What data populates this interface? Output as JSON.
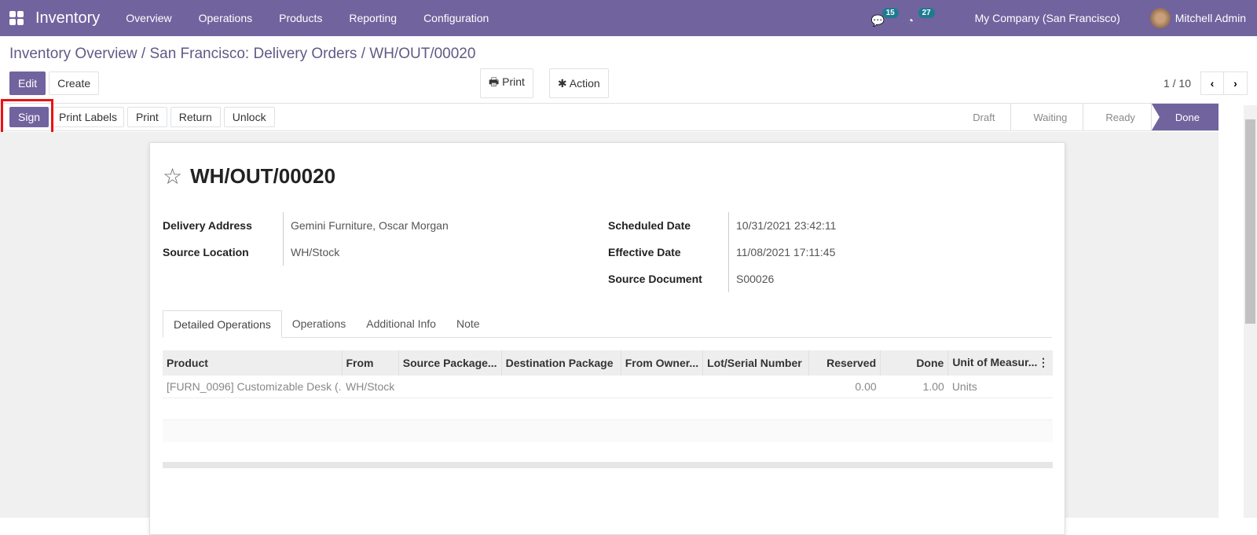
{
  "nav": {
    "app": "Inventory",
    "menu": [
      "Overview",
      "Operations",
      "Products",
      "Reporting",
      "Configuration"
    ],
    "messages_count": "15",
    "activities_count": "27",
    "company": "My Company (San Francisco)",
    "user": "Mitchell Admin"
  },
  "breadcrumb": {
    "items": [
      "Inventory Overview",
      "San Francisco: Delivery Orders"
    ],
    "current": "WH/OUT/00020"
  },
  "control": {
    "edit": "Edit",
    "create": "Create",
    "print": "Print",
    "action": "Action",
    "pager": "1 / 10"
  },
  "header_buttons": [
    "Sign",
    "Print Labels",
    "Print",
    "Return",
    "Unlock"
  ],
  "status_steps": [
    "Draft",
    "Waiting",
    "Ready",
    "Done"
  ],
  "status_current": "Done",
  "accent": "#71639e",
  "record": {
    "name": "WH/OUT/00020",
    "left": [
      {
        "label": "Delivery Address",
        "value": "Gemini Furniture, Oscar Morgan"
      },
      {
        "label": "Source Location",
        "value": "WH/Stock"
      }
    ],
    "right": [
      {
        "label": "Scheduled Date",
        "value": "10/31/2021 23:42:11"
      },
      {
        "label": "Effective Date",
        "value": "11/08/2021 17:11:45"
      },
      {
        "label": "Source Document",
        "value": "S00026"
      }
    ]
  },
  "tabs": [
    "Detailed Operations",
    "Operations",
    "Additional Info",
    "Note"
  ],
  "table": {
    "columns": [
      "Product",
      "From",
      "Source Package...",
      "Destination Package",
      "From Owner...",
      "Lot/Serial Number",
      "Reserved",
      "Done",
      "Unit of Measur..."
    ],
    "rows": [
      [
        "[FURN_0096] Customizable Desk (...",
        "WH/Stock",
        "",
        "",
        "",
        "",
        "0.00",
        "1.00",
        "Units"
      ]
    ]
  }
}
